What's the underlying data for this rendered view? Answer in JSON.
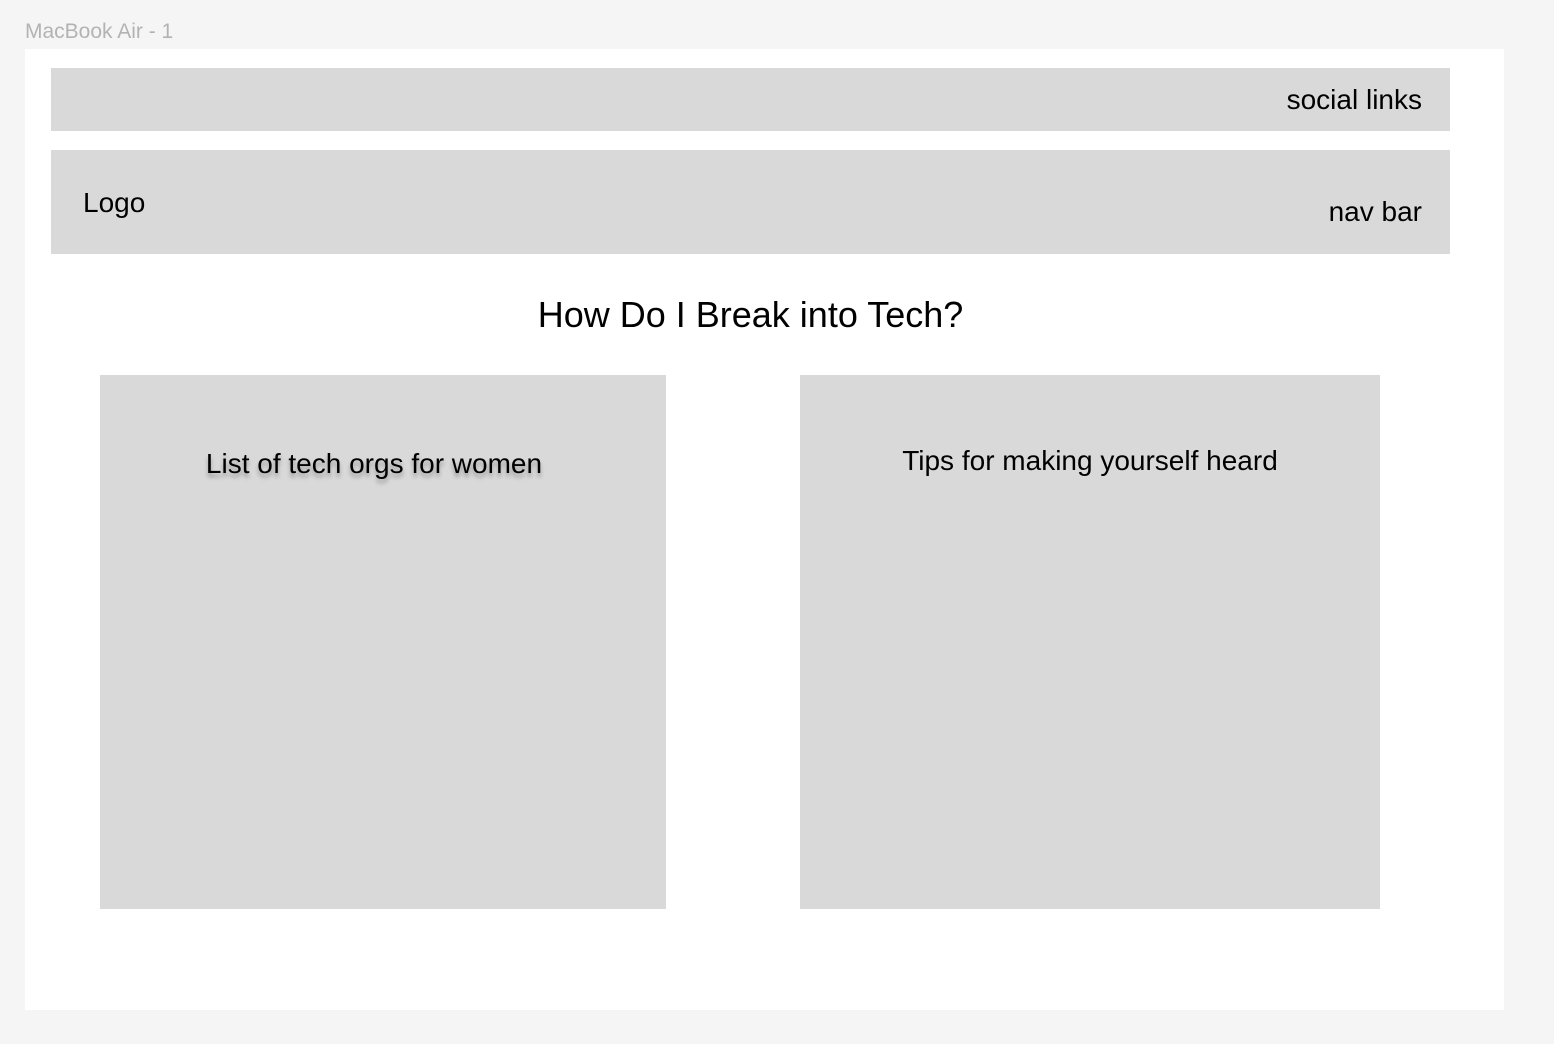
{
  "frame_label": "MacBook Air - 1",
  "header": {
    "social_links": "social links",
    "logo": "Logo",
    "nav_bar": "nav bar"
  },
  "main": {
    "title": "How Do I Break into Tech?",
    "cards": [
      {
        "title": "List of tech orgs for women"
      },
      {
        "title": "Tips for making yourself heard"
      }
    ]
  },
  "colors": {
    "canvas_background": "#f5f5f5",
    "frame_background": "#ffffff",
    "placeholder_fill": "#d9d9d9",
    "frame_label": "#b3b3b3",
    "text": "#000000"
  }
}
